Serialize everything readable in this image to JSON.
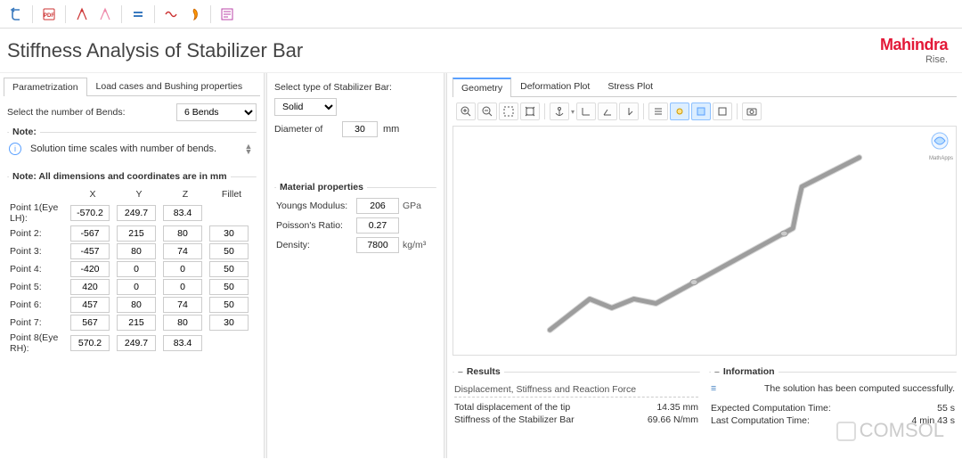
{
  "title": "Stiffness Analysis of Stabilizer Bar",
  "brand": {
    "main": "Mahindra",
    "sub": "Rise."
  },
  "tabs": {
    "param": "Parametrization",
    "loads": "Load cases and Bushing properties"
  },
  "left": {
    "bends_label": "Select the number of Bends:",
    "bends_value": "6 Bends",
    "note_legend": "Note:",
    "note_text": "Solution time scales with number of bends.",
    "dims_legend": "Note: All dimensions and coordinates are in mm",
    "headers": {
      "x": "X",
      "y": "Y",
      "z": "Z",
      "fillet": "Fillet"
    },
    "points": [
      {
        "label": "Point 1(Eye LH):",
        "x": "-570.2",
        "y": "249.7",
        "z": "83.4",
        "f": ""
      },
      {
        "label": "Point 2:",
        "x": "-567",
        "y": "215",
        "z": "80",
        "f": "30"
      },
      {
        "label": "Point 3:",
        "x": "-457",
        "y": "80",
        "z": "74",
        "f": "50"
      },
      {
        "label": "Point 4:",
        "x": "-420",
        "y": "0",
        "z": "0",
        "f": "50"
      },
      {
        "label": "Point 5:",
        "x": "420",
        "y": "0",
        "z": "0",
        "f": "50"
      },
      {
        "label": "Point 6:",
        "x": "457",
        "y": "80",
        "z": "74",
        "f": "50"
      },
      {
        "label": "Point 7:",
        "x": "567",
        "y": "215",
        "z": "80",
        "f": "30"
      },
      {
        "label": "Point 8(Eye RH):",
        "x": "570.2",
        "y": "249.7",
        "z": "83.4",
        "f": ""
      }
    ]
  },
  "mid": {
    "type_label": "Select type of Stabilizer Bar:",
    "type_value": "Solid",
    "diam_label": "Diameter of",
    "diam_value": "30",
    "diam_unit": "mm",
    "mat_legend": "Material properties",
    "ym_label": "Youngs Modulus:",
    "ym_value": "206",
    "ym_unit": "GPa",
    "pr_label": "Poisson's Ratio:",
    "pr_value": "0.27",
    "den_label": "Density:",
    "den_value": "7800",
    "den_unit": "kg/m³"
  },
  "right": {
    "tabs": {
      "geom": "Geometry",
      "def": "Deformation Plot",
      "stress": "Stress Plot"
    },
    "results_legend": "Results",
    "results_sub": "Displacement, Stiffness and Reaction Force",
    "disp_label": "Total displacement of the tip",
    "disp_value": "14.35 mm",
    "stiff_label": "Stiffness of the Stabilizer Bar",
    "stiff_value": "69.66 N/mm",
    "info_legend": "Information",
    "info_msg": "The solution has been computed successfully.",
    "exp_label": "Expected Computation Time:",
    "exp_value": "55 s",
    "last_label": "Last Computation Time:",
    "last_value": "4 min 43 s",
    "viewport_brand": "MathApps"
  },
  "watermark": "COMSOL"
}
